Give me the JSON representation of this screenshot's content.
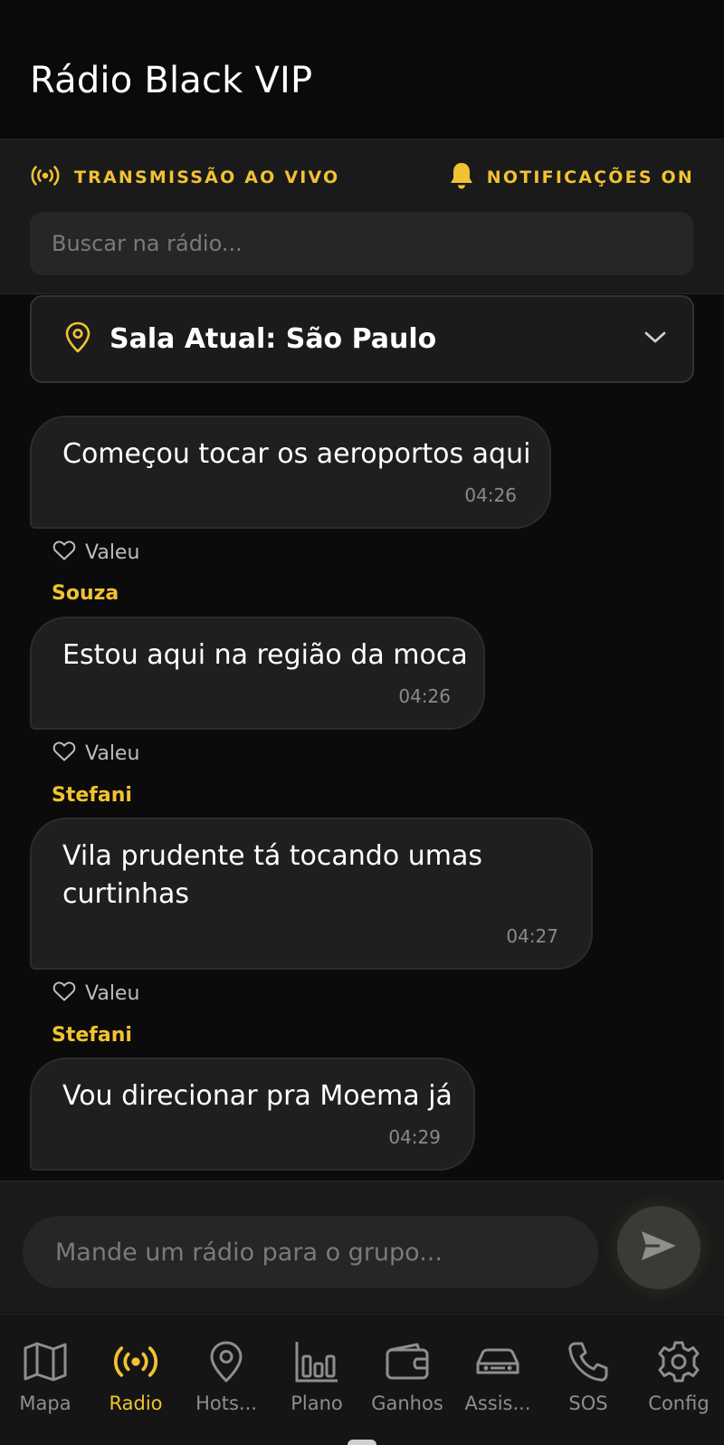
{
  "app": {
    "title": "Rádio Black VIP"
  },
  "status": {
    "live_label": "TRANSMISSÃO AO VIVO",
    "notifications_label": "NOTIFICAÇÕES ON",
    "live_icon": "broadcast-icon",
    "notifications_icon": "bell-icon"
  },
  "search": {
    "placeholder": "Buscar na rádio..."
  },
  "room": {
    "label": "Sala Atual: São Paulo",
    "icon": "map-pin-icon"
  },
  "messages": [
    {
      "author": "",
      "text": "Começou tocar os aeroportos aqui",
      "time": "04:26",
      "like_label": "Valeu"
    },
    {
      "author": "Souza",
      "text": "Estou aqui na região da moca",
      "time": "04:26",
      "like_label": "Valeu"
    },
    {
      "author": "Stefani",
      "text": "Vila prudente tá tocando umas curtinhas",
      "time": "04:27",
      "like_label": "Valeu"
    },
    {
      "author": "Stefani",
      "text": "Vou direcionar pra Moema já",
      "time": "04:29",
      "like_label": ""
    }
  ],
  "composer": {
    "placeholder": "Mande um rádio para o grupo..."
  },
  "nav": [
    {
      "label": "Mapa",
      "icon": "map-icon",
      "active": false
    },
    {
      "label": "Radio",
      "icon": "radio-broadcast-icon",
      "active": true
    },
    {
      "label": "Hots...",
      "icon": "location-pin-icon",
      "active": false
    },
    {
      "label": "Plano",
      "icon": "bar-chart-icon",
      "active": false
    },
    {
      "label": "Ganhos",
      "icon": "wallet-icon",
      "active": false
    },
    {
      "label": "Assis...",
      "icon": "car-icon",
      "active": false
    },
    {
      "label": "SOS",
      "icon": "phone-icon",
      "active": false
    },
    {
      "label": "Config",
      "icon": "gear-icon",
      "active": false
    }
  ],
  "colors": {
    "accent": "#f1c232",
    "background": "#0b0b0b",
    "panel": "#1a1a1a",
    "bubble": "#1f1f1f"
  }
}
